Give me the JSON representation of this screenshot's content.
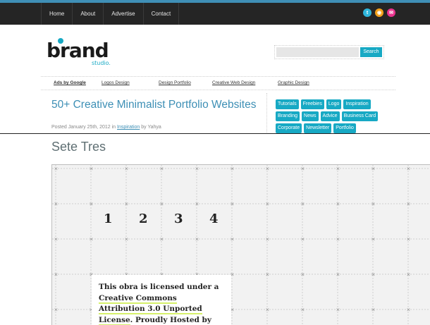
{
  "nav": {
    "items": [
      "Home",
      "About",
      "Advertise",
      "Contact"
    ]
  },
  "social": [
    {
      "icon": "twitter-icon",
      "glyph": "t",
      "color": "#2fb6dc"
    },
    {
      "icon": "rss-icon",
      "glyph": "◉",
      "color": "#f4a21c"
    },
    {
      "icon": "mail-icon",
      "glyph": "✉",
      "color": "#e8338e"
    }
  ],
  "logo": {
    "text": "brand",
    "sub": "studio."
  },
  "search": {
    "button": "Search",
    "placeholder": ""
  },
  "ads": {
    "label": "Ads by Google",
    "links": [
      "Logos Design",
      "Design Portfolio",
      "Creative Web Design",
      "Graphic Design"
    ]
  },
  "post": {
    "title": "50+ Creative Minimalist Portfolio Websites",
    "meta_prefix": "Posted January 25th, 2012 in ",
    "meta_category": "Inspiration",
    "meta_suffix": " by Yahya"
  },
  "tags": [
    "Tutorials",
    "Freebies",
    "Logo",
    "Inspiration",
    "Branding",
    "News",
    "Advice",
    "Business Card",
    "Corporate",
    "Newsletter",
    "Portfolio"
  ],
  "site2": {
    "title": "Sete Tres",
    "numbers": [
      "1",
      "2",
      "3",
      "4"
    ],
    "license_parts": [
      {
        "text": "This obra is licensed under a ",
        "hl": false
      },
      {
        "text": "Creative Commons Attribution 3.0 Unported License",
        "hl": true
      },
      {
        "text": ". Proudly Hosted by",
        "hl": false
      }
    ]
  },
  "colors": {
    "accent": "#17a9c4",
    "title_blue": "#3d8fb5",
    "topbar": "#252525",
    "highlight": "#d6f06a"
  }
}
